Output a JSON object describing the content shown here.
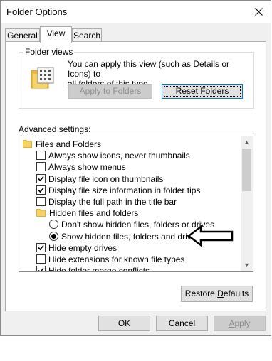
{
  "window": {
    "title": "Folder Options"
  },
  "tabs": [
    {
      "label": "General",
      "active": false
    },
    {
      "label": "View",
      "active": true
    },
    {
      "label": "Search",
      "active": false
    }
  ],
  "folder_views": {
    "title": "Folder views",
    "description": "You can apply this view (such as Details or Icons) to\nall folders of this type.",
    "apply_button": {
      "label": "Apply to Folders",
      "enabled": false
    },
    "reset_button": {
      "before": "",
      "underlined": "R",
      "after": "eset Folders"
    }
  },
  "advanced": {
    "label": "Advanced settings:",
    "items": [
      {
        "type": "folder",
        "label": "Files and Folders",
        "indent": 0
      },
      {
        "type": "checkbox",
        "label": "Always show icons, never thumbnails",
        "checked": false,
        "indent": 1
      },
      {
        "type": "checkbox",
        "label": "Always show menus",
        "checked": false,
        "indent": 1
      },
      {
        "type": "checkbox",
        "label": "Display file icon on thumbnails",
        "checked": true,
        "indent": 1
      },
      {
        "type": "checkbox",
        "label": "Display file size information in folder tips",
        "checked": true,
        "indent": 1
      },
      {
        "type": "checkbox",
        "label": "Display the full path in the title bar",
        "checked": false,
        "indent": 1
      },
      {
        "type": "folder",
        "label": "Hidden files and folders",
        "indent": 1
      },
      {
        "type": "radio",
        "label": "Don't show hidden files, folders or drives",
        "checked": false,
        "indent": 2
      },
      {
        "type": "radio",
        "label": "Show hidden files, folders and drives",
        "checked": true,
        "indent": 2
      },
      {
        "type": "checkbox",
        "label": "Hide empty drives",
        "checked": true,
        "indent": 1
      },
      {
        "type": "checkbox",
        "label": "Hide extensions for known file types",
        "checked": false,
        "indent": 1
      },
      {
        "type": "checkbox",
        "label": "Hide folder merge conflicts",
        "checked": true,
        "indent": 1
      }
    ]
  },
  "restore_button": {
    "before": "Restore ",
    "underlined": "D",
    "after": "efaults"
  },
  "footer": {
    "ok": "OK",
    "cancel": "Cancel",
    "apply": {
      "before": "",
      "underlined": "A",
      "after": "pply",
      "enabled": false
    }
  },
  "colors": {
    "focus": "#0078d7",
    "window_bg": "#f0f0f0",
    "folder": "#f6d365"
  }
}
